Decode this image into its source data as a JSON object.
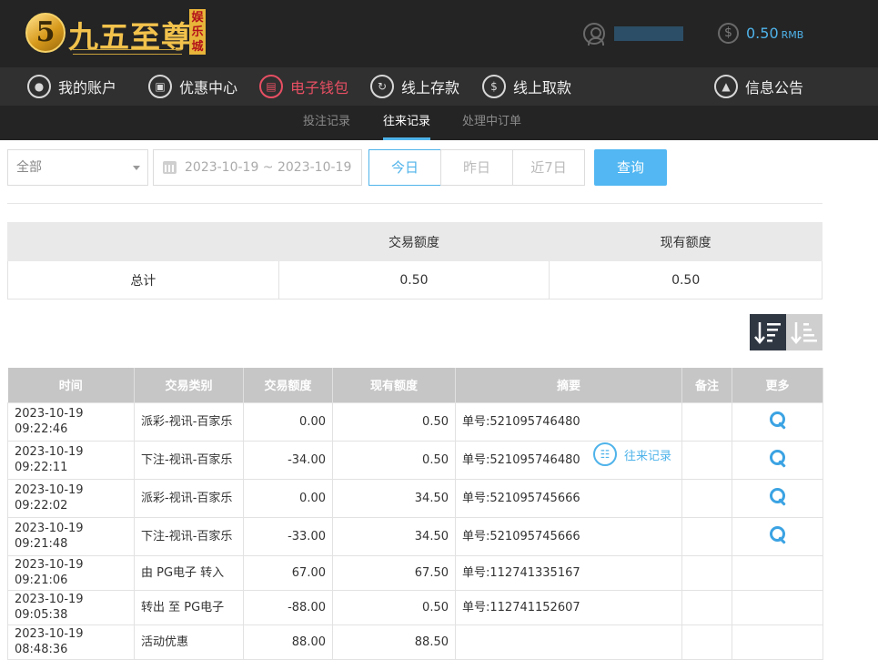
{
  "brand": {
    "name": "九五至尊",
    "digit": "5",
    "badge": "娱乐城"
  },
  "account": {
    "balance": "0.50",
    "currency": "RMB"
  },
  "main_nav": [
    {
      "label": "我的账户",
      "icon": "user-circle-icon"
    },
    {
      "label": "优惠中心",
      "icon": "gift-icon"
    },
    {
      "label": "电子钱包",
      "icon": "wallet-icon"
    },
    {
      "label": "线上存款",
      "icon": "deposit-icon"
    },
    {
      "label": "线上取款",
      "icon": "withdraw-icon"
    },
    {
      "label": "往来记录",
      "icon": "records-icon"
    },
    {
      "label": "信息公告",
      "icon": "bell-icon"
    }
  ],
  "sub_nav": [
    {
      "label": "投注记录"
    },
    {
      "label": "往来记录"
    },
    {
      "label": "处理中订单"
    }
  ],
  "filters": {
    "type_value": "全部",
    "date_range": "2023-10-19 ~ 2023-10-19",
    "quick": [
      "今日",
      "昨日",
      "近7日"
    ],
    "search_label": "查询"
  },
  "summary": {
    "headers": [
      "",
      "交易额度",
      "现有额度"
    ],
    "row": [
      "总计",
      "0.50",
      "0.50"
    ]
  },
  "table": {
    "headers": [
      "时间",
      "交易类别",
      "交易额度",
      "现有额度",
      "摘要",
      "备注",
      "更多"
    ],
    "rows": [
      {
        "time": "2023-10-19 09:22:46",
        "type": "派彩-视讯-百家乐",
        "amount": "0.00",
        "balance": "0.50",
        "summary": "单号:521095746480",
        "note": "",
        "more": true
      },
      {
        "time": "2023-10-19 09:22:11",
        "type": "下注-视讯-百家乐",
        "amount": "-34.00",
        "balance": "0.50",
        "summary": "单号:521095746480",
        "note": "",
        "more": true
      },
      {
        "time": "2023-10-19 09:22:02",
        "type": "派彩-视讯-百家乐",
        "amount": "0.00",
        "balance": "34.50",
        "summary": "单号:521095745666",
        "note": "",
        "more": true
      },
      {
        "time": "2023-10-19 09:21:48",
        "type": "下注-视讯-百家乐",
        "amount": "-33.00",
        "balance": "34.50",
        "summary": "单号:521095745666",
        "note": "",
        "more": true
      },
      {
        "time": "2023-10-19 09:21:06",
        "type": "由 PG电子 转入",
        "amount": "67.00",
        "balance": "67.50",
        "summary": "单号:112741335167",
        "note": "",
        "more": false
      },
      {
        "time": "2023-10-19 09:05:38",
        "type": "转出 至 PG电子",
        "amount": "-88.00",
        "balance": "0.50",
        "summary": "单号:112741152607",
        "note": "",
        "more": false
      },
      {
        "time": "2023-10-19 08:48:36",
        "type": "活动优惠",
        "amount": "88.00",
        "balance": "88.50",
        "summary": "",
        "note": "",
        "more": false
      }
    ]
  }
}
